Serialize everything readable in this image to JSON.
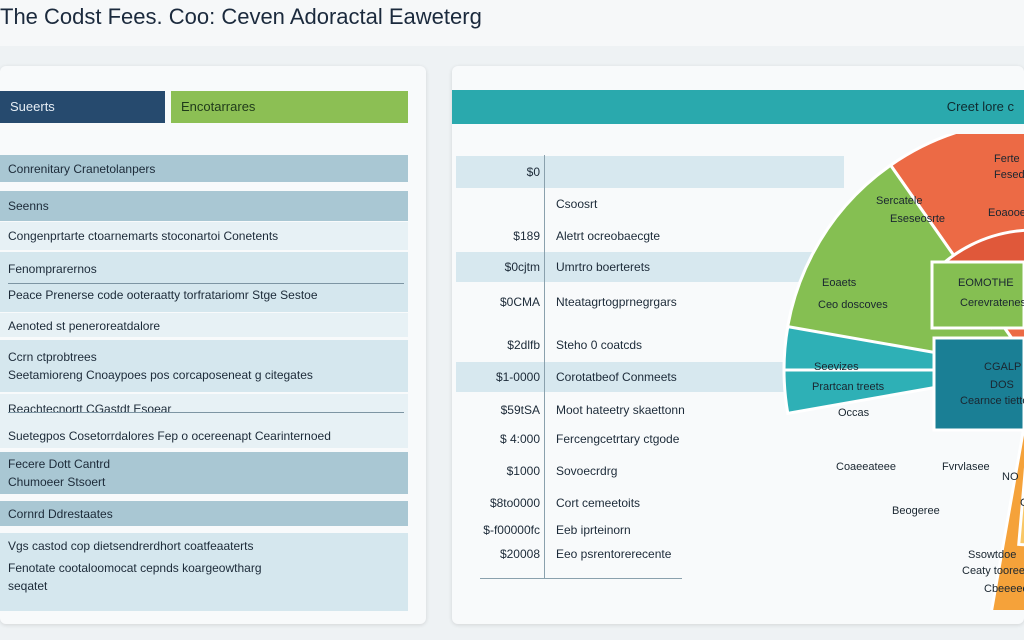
{
  "header": {
    "title": "The Codst Fees. Coo: Ceven Adoractal Eaweterg"
  },
  "left": {
    "tabs": [
      "Sueerts",
      "Encotarrares"
    ],
    "rows": [
      [
        "Conrenitary Cranetolanpers"
      ],
      [
        "Seenns"
      ],
      [
        "Congenprtarte ctoarnemarts stoconartoi Conetents"
      ],
      [
        "Fenomprarernos",
        "Peace Prenerse code ooteraatty torfratariomr Stge Sestoe"
      ],
      [
        "Aenoted st peneroreatdalore"
      ],
      [
        "Ccrn ctprobtrees",
        "Seetamioreng Cnoaypoes pos corcaposeneat g citegates"
      ],
      [
        "Reachtecnortt CGastdt Esoear",
        "Suetegpos Cosetorrdalores Fep o ocereenapt Cearinternoed"
      ],
      [
        "Fecere Dott Cantrd",
        "Chumoeer Stsoert"
      ],
      [
        "Cornrd Ddrestaates"
      ],
      [
        "Vgs castod cop dietsendrerdhort coatfeaaterts",
        "Fenotate cootaloomocat cepnds koargeowtharg",
        "seqatet"
      ]
    ]
  },
  "right": {
    "header": "Creet lore c",
    "prices": [
      [
        "$0",
        ""
      ],
      [
        "",
        "Csoosrt"
      ],
      [
        "$189",
        "Aletrt ocreobaecgte"
      ],
      [
        "$0cjtm",
        "Umrtro boerterets"
      ],
      [
        "$0CMA",
        "Nteatagrtogprnegrgars"
      ],
      [
        "$2dlfb",
        "Steho 0 coatcds"
      ],
      [
        "$1-0000",
        "Corotatbeof Conmeets"
      ],
      [
        "$59tSA",
        "Moot hateetry skaettonn"
      ],
      [
        "$ 4:000",
        "Fercengcetrtary ctgode"
      ],
      [
        "$1000",
        "Sovoecrdrg"
      ],
      [
        "$8to0000",
        "Cort cemeetoits"
      ],
      [
        "$-f00000fc",
        "Eeb iprteinorn"
      ],
      [
        "$20008",
        "Eeo psrentorerecente"
      ]
    ],
    "pie": {
      "segments": [
        "Ferte",
        "Fesede",
        "Eoaooed",
        "Sercatele",
        "Eseseosrte",
        "Eoaets",
        "Ceo doscoves",
        "EOMOTHE",
        "Cerevratenes",
        "Seevizes",
        "Prartcan treets",
        "Occas",
        "CGALP",
        "DOS",
        "Cearnce tiettoe",
        "Coaeeateee",
        "Beogeree",
        "NO",
        "Fvrvlasee",
        "Cy toce",
        "Ssowtdoe",
        "Ceaty toorees",
        "Cbeeeeco"
      ],
      "colors": [
        "#ec6a45",
        "#85bf52",
        "#2eb0b6",
        "#1a7f95",
        "#f5a23a",
        "#f9c766"
      ]
    }
  }
}
